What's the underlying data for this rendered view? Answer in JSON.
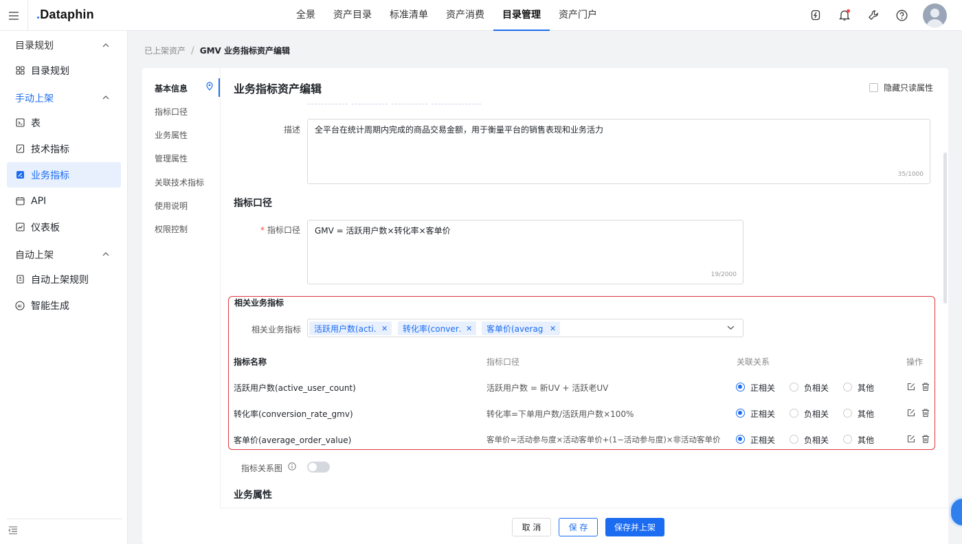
{
  "topbar": {
    "logo": "Dataphin",
    "nav": [
      "全景",
      "资产目录",
      "标准清单",
      "资产消费",
      "目录管理",
      "资产门户"
    ],
    "active_nav": "目录管理"
  },
  "sidebar": {
    "group1": "目录规划",
    "item_catalog": "目录规划",
    "group2": "手动上架",
    "item_table": "表",
    "item_tech": "技术指标",
    "item_biz": "业务指标",
    "item_api": "API",
    "item_dashboard": "仪表板",
    "group3": "自动上架",
    "item_autorule": "自动上架规则",
    "item_smart": "智能生成"
  },
  "breadcrumb": {
    "parent": "已上架资产",
    "sep": "/",
    "current": "GMV 业务指标资产编辑"
  },
  "anchor": [
    "基本信息",
    "指标口径",
    "业务属性",
    "管理属性",
    "关联技术指标",
    "使用说明",
    "权限控制"
  ],
  "form": {
    "title": "业务指标资产编辑",
    "hide_readonly": "隐藏只读属性",
    "desc_label": "描述",
    "desc_value": "全平台在统计周期内完成的商品交易金额，用于衡量平台的销售表现和业务活力",
    "desc_count": "35/1000",
    "section_caliber": "指标口径",
    "caliber_label": "指标口径",
    "caliber_value": "GMV = 活跃用户数×转化率×客单价",
    "caliber_count": "19/2000",
    "related_title": "相关业务指标",
    "related_label": "相关业务指标",
    "tags": [
      "活跃用户数(acti…",
      "转化率(conver…",
      "客单价(averag…"
    ],
    "table_headers": [
      "指标名称",
      "指标口径",
      "关联关系",
      "操作"
    ],
    "rows": [
      {
        "name": "活跃用户数(active_user_count)",
        "caliber": "活跃用户数 = 新UV + 活跃老UV"
      },
      {
        "name": "转化率(conversion_rate_gmv)",
        "caliber": "转化率=下单用户数/活跃用户数×100%"
      },
      {
        "name": "客单价(average_order_value)",
        "caliber": "客单价=活动参与度×活动客单价+(1−活动参与度)×非活动客单价"
      }
    ],
    "relation_options": [
      "正相关",
      "负相关",
      "其他"
    ],
    "relation_selected": "正相关",
    "graph_label": "指标关系图",
    "graph_enabled": false,
    "section_biz": "业务属性"
  },
  "footer": {
    "cancel": "取 消",
    "save": "保 存",
    "save_publish": "保存并上架"
  },
  "colors": {
    "accent": "#1b6cf0",
    "highlight_border": "#e0363b",
    "notification_dot": "#f54a45"
  }
}
